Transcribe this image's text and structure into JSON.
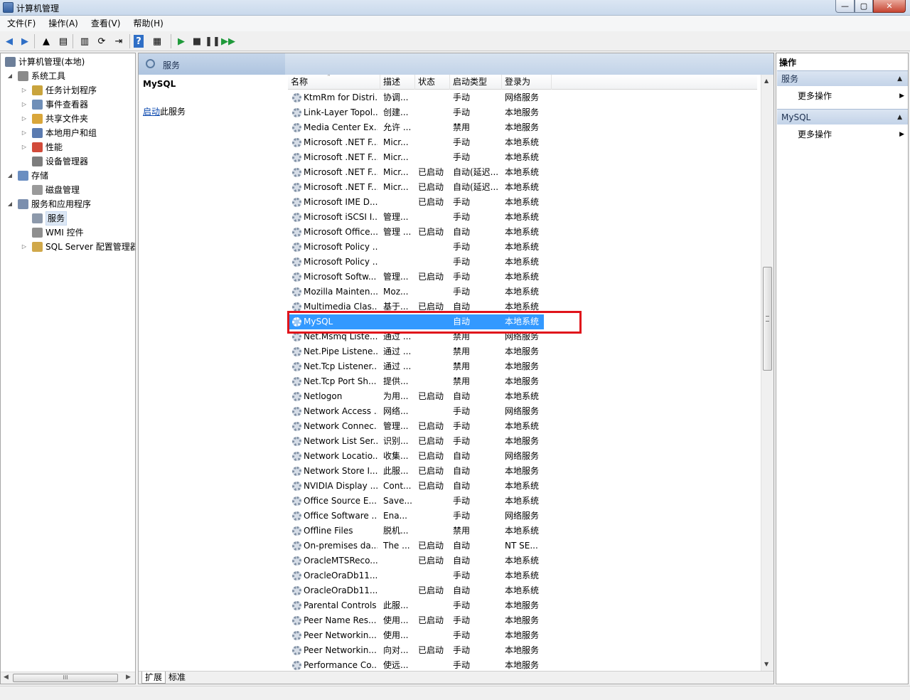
{
  "window": {
    "title": "计算机管理",
    "controls": {
      "minimize": "—",
      "maximize": "▢",
      "close": "✕"
    }
  },
  "menubar": [
    "文件(F)",
    "操作(A)",
    "查看(V)",
    "帮助(H)"
  ],
  "toolbar": {
    "icons": [
      "back-arrow-icon",
      "forward-arrow-icon",
      "up-folder-icon",
      "show-hide-tree-icon",
      "properties-icon",
      "refresh-icon",
      "export-list-icon",
      "help-icon",
      "show-hide-action-pane-icon",
      "start-service-icon",
      "stop-service-icon",
      "pause-service-icon",
      "resume-service-icon"
    ],
    "glyphs": [
      "◀",
      "▶",
      "▲",
      "▤",
      "▥",
      "⟳",
      "⇥",
      "?",
      "▦",
      "▶",
      "■",
      "❚❚",
      "▶▶"
    ],
    "colors": {
      "back": "#2f6fc6",
      "play": "#1f9a3a",
      "stop": "#333333"
    }
  },
  "tree": {
    "items": [
      {
        "label": "计算机管理(本地)",
        "icon": "computer-management-icon",
        "expander": ""
      },
      {
        "label": "系统工具",
        "icon": "system-tools-icon",
        "expander": "◢"
      },
      {
        "label": "任务计划程序",
        "icon": "task-scheduler-icon",
        "expander": "▷"
      },
      {
        "label": "事件查看器",
        "icon": "event-viewer-icon",
        "expander": "▷"
      },
      {
        "label": "共享文件夹",
        "icon": "shared-folders-icon",
        "expander": "▷"
      },
      {
        "label": "本地用户和组",
        "icon": "local-users-groups-icon",
        "expander": "▷"
      },
      {
        "label": "性能",
        "icon": "performance-icon",
        "expander": "▷"
      },
      {
        "label": "设备管理器",
        "icon": "device-manager-icon",
        "expander": ""
      },
      {
        "label": "存储",
        "icon": "storage-icon",
        "expander": "◢"
      },
      {
        "label": "磁盘管理",
        "icon": "disk-management-icon",
        "expander": ""
      },
      {
        "label": "服务和应用程序",
        "icon": "services-applications-icon",
        "expander": "◢"
      },
      {
        "label": "服务",
        "icon": "services-gear-icon",
        "expander": ""
      },
      {
        "label": "WMI 控件",
        "icon": "wmi-control-icon",
        "expander": ""
      },
      {
        "label": "SQL Server 配置管理器",
        "icon": "sql-server-config-icon",
        "expander": "▷"
      }
    ],
    "scroll_thumb_label": "III"
  },
  "center": {
    "header_title": "服务",
    "selected_service": "MySQL",
    "start_link": "启动",
    "start_suffix": "此服务",
    "columns": [
      "名称",
      "描述",
      "状态",
      "启动类型",
      "登录为"
    ],
    "services": [
      [
        "KtmRm for Distri...",
        "协调...",
        "",
        "手动",
        "网络服务"
      ],
      [
        "Link-Layer Topol...",
        "创建...",
        "",
        "手动",
        "本地服务"
      ],
      [
        "Media Center Ex...",
        "允许 ...",
        "",
        "禁用",
        "本地服务"
      ],
      [
        "Microsoft .NET F...",
        "Micr...",
        "",
        "手动",
        "本地系统"
      ],
      [
        "Microsoft .NET F...",
        "Micr...",
        "",
        "手动",
        "本地系统"
      ],
      [
        "Microsoft .NET F...",
        "Micr...",
        "已启动",
        "自动(延迟...",
        "本地系统"
      ],
      [
        "Microsoft .NET F...",
        "Micr...",
        "已启动",
        "自动(延迟...",
        "本地系统"
      ],
      [
        "Microsoft IME D...",
        "",
        "已启动",
        "手动",
        "本地系统"
      ],
      [
        "Microsoft iSCSI I...",
        "管理...",
        "",
        "手动",
        "本地系统"
      ],
      [
        "Microsoft Office...",
        "管理 ...",
        "已启动",
        "自动",
        "本地系统"
      ],
      [
        "Microsoft Policy ...",
        "",
        "",
        "手动",
        "本地系统"
      ],
      [
        "Microsoft Policy ...",
        "",
        "",
        "手动",
        "本地系统"
      ],
      [
        "Microsoft Softw...",
        "管理...",
        "已启动",
        "手动",
        "本地系统"
      ],
      [
        "Mozilla Mainten...",
        "Moz...",
        "",
        "手动",
        "本地系统"
      ],
      [
        "Multimedia Clas...",
        "基于...",
        "已启动",
        "自动",
        "本地系统"
      ],
      [
        "MySQL",
        "",
        "",
        "自动",
        "本地系统"
      ],
      [
        "Net.Msmq Liste...",
        "通过 ...",
        "",
        "禁用",
        "网络服务"
      ],
      [
        "Net.Pipe Listene...",
        "通过 ...",
        "",
        "禁用",
        "本地服务"
      ],
      [
        "Net.Tcp Listener...",
        "通过 ...",
        "",
        "禁用",
        "本地服务"
      ],
      [
        "Net.Tcp Port Sh...",
        "提供...",
        "",
        "禁用",
        "本地服务"
      ],
      [
        "Netlogon",
        "为用...",
        "已启动",
        "自动",
        "本地系统"
      ],
      [
        "Network Access ...",
        "网络...",
        "",
        "手动",
        "网络服务"
      ],
      [
        "Network Connec...",
        "管理...",
        "已启动",
        "手动",
        "本地系统"
      ],
      [
        "Network List Ser...",
        "识别...",
        "已启动",
        "手动",
        "本地服务"
      ],
      [
        "Network Locatio...",
        "收集...",
        "已启动",
        "自动",
        "网络服务"
      ],
      [
        "Network Store I...",
        "此服...",
        "已启动",
        "自动",
        "本地服务"
      ],
      [
        "NVIDIA Display ...",
        "Cont...",
        "已启动",
        "自动",
        "本地系统"
      ],
      [
        "Office  Source E...",
        "Save...",
        "",
        "手动",
        "本地系统"
      ],
      [
        "Office Software ...",
        "Ena...",
        "",
        "手动",
        "网络服务"
      ],
      [
        "Offline Files",
        "脱机...",
        "",
        "禁用",
        "本地系统"
      ],
      [
        "On-premises da...",
        "The ...",
        "已启动",
        "自动",
        "NT SE..."
      ],
      [
        "OracleMTSReco...",
        "",
        "已启动",
        "自动",
        "本地系统"
      ],
      [
        "OracleOraDb11...",
        "",
        "",
        "手动",
        "本地系统"
      ],
      [
        "OracleOraDb11...",
        "",
        "已启动",
        "自动",
        "本地系统"
      ],
      [
        "Parental Controls",
        "此服...",
        "",
        "手动",
        "本地服务"
      ],
      [
        "Peer Name Res...",
        "使用...",
        "已启动",
        "手动",
        "本地服务"
      ],
      [
        "Peer Networkin...",
        "使用...",
        "",
        "手动",
        "本地服务"
      ],
      [
        "Peer Networkin...",
        "向对...",
        "已启动",
        "手动",
        "本地服务"
      ],
      [
        "Performance Co...",
        "使远...",
        "",
        "手动",
        "本地服务"
      ]
    ],
    "tabs": [
      "扩展",
      "标准"
    ],
    "selection_color": "#3399ff",
    "highlight_color": "#e0141b"
  },
  "actions": {
    "title": "操作",
    "sections": [
      {
        "label": "服务",
        "item": "更多操作"
      },
      {
        "label": "MySQL",
        "item": "更多操作"
      }
    ]
  }
}
